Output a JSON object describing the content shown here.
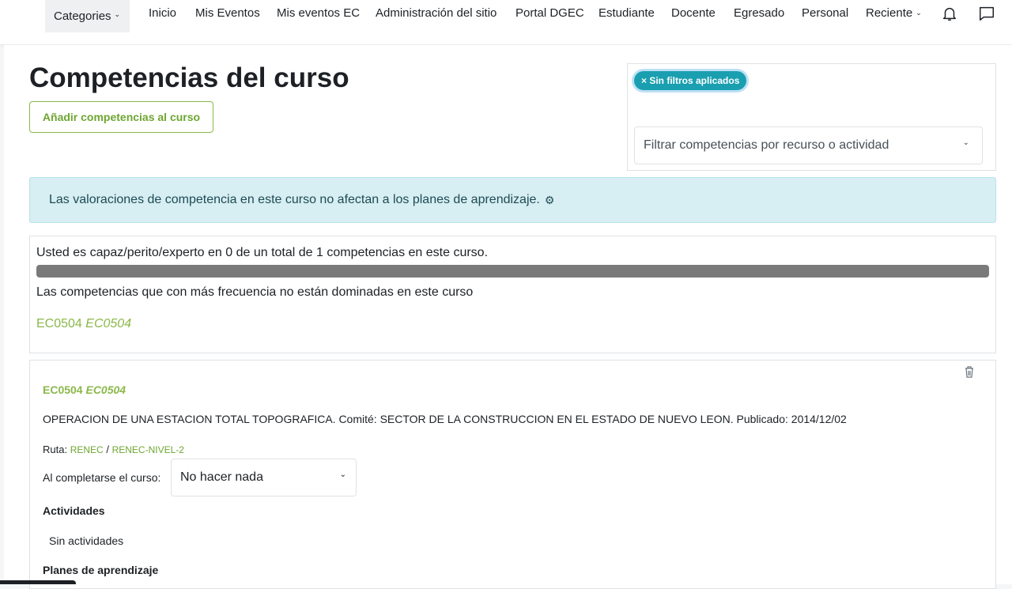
{
  "nav": {
    "categories_label": "Categories",
    "items": [
      "Inicio",
      "Mis Eventos",
      "Mis eventos EC",
      "Administración del sitio",
      "Portal DGEC",
      "Estudiante",
      "Docente",
      "Egresado",
      "Personal"
    ],
    "recent_label": "Reciente",
    "icons": [
      "bell-icon",
      "chat-icon"
    ]
  },
  "page": {
    "title": "Competencias del curso",
    "add_button": "Añadir competencias al curso"
  },
  "filter": {
    "pill_label": "× Sin filtros aplicados",
    "select_placeholder": "Filtrar competencias por recurso o actividad"
  },
  "alert": {
    "text": "Las valoraciones de competencia en este curso no afectan a los planes de aprendizaje."
  },
  "summary": {
    "text": "Usted es capaz/perito/experto en 0 de un total de 1 competencias en este curso.",
    "progress_percent": 100,
    "frequent_text": "Las competencias que con más frecuencia no están dominadas en este curso",
    "frequent_code": "EC0504",
    "frequent_code_italic": "EC0504"
  },
  "competency": {
    "code": "EC0504",
    "code_italic": "EC0504",
    "description": "OPERACION DE UNA ESTACION TOTAL TOPOGRAFICA. Comité: SECTOR DE LA CONSTRUCCION EN EL ESTADO DE NUEVO LEON. Publicado: 2014/12/02",
    "path_label": "Ruta:",
    "path_items": [
      "RENEC",
      "RENEC-NIVEL-2"
    ],
    "path_separator": " / ",
    "completion_label": "Al completarse el curso:",
    "completion_value": "No hacer nada",
    "activities_heading": "Actividades",
    "activities_empty": "Sin actividades",
    "plans_heading": "Planes de aprendizaje"
  }
}
